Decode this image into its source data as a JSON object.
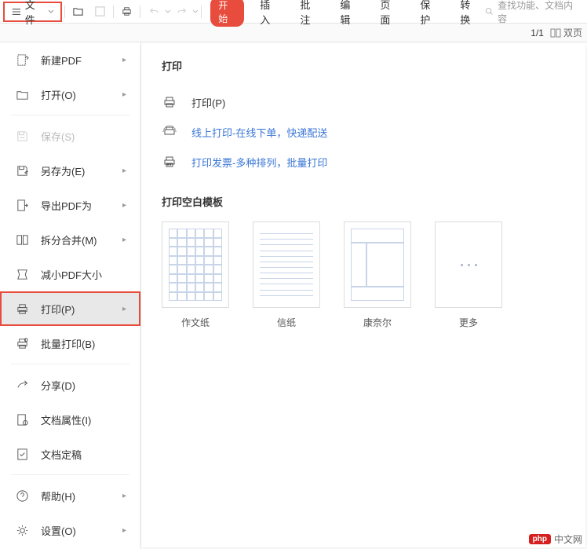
{
  "toolbar": {
    "file_label": "文件",
    "tabs": [
      "开始",
      "插入",
      "批注",
      "编辑",
      "页面",
      "保护",
      "转换"
    ],
    "search_placeholder": "查找功能、文档内容"
  },
  "secondbar": {
    "page": "1/1",
    "view_label": "双页"
  },
  "sidebar": {
    "groups": [
      [
        {
          "label": "新建PDF",
          "arrow": true,
          "disabled": false
        },
        {
          "label": "打开(O)",
          "arrow": true,
          "disabled": false
        }
      ],
      [
        {
          "label": "保存(S)",
          "arrow": false,
          "disabled": true
        },
        {
          "label": "另存为(E)",
          "arrow": true,
          "disabled": false
        },
        {
          "label": "导出PDF为",
          "arrow": true,
          "disabled": false
        },
        {
          "label": "拆分合并(M)",
          "arrow": true,
          "disabled": false
        },
        {
          "label": "减小PDF大小",
          "arrow": false,
          "disabled": false
        },
        {
          "label": "打印(P)",
          "arrow": true,
          "disabled": false,
          "active": true,
          "highlighted": true
        },
        {
          "label": "批量打印(B)",
          "arrow": false,
          "disabled": false
        }
      ],
      [
        {
          "label": "分享(D)",
          "arrow": false,
          "disabled": false
        },
        {
          "label": "文档属性(I)",
          "arrow": false,
          "disabled": false
        },
        {
          "label": "文档定稿",
          "arrow": false,
          "disabled": false
        }
      ],
      [
        {
          "label": "帮助(H)",
          "arrow": true,
          "disabled": false
        },
        {
          "label": "设置(O)",
          "arrow": true,
          "disabled": false
        }
      ]
    ]
  },
  "panel": {
    "title1": "打印",
    "row_print": "打印(P)",
    "row_online": "线上打印-在线下单，快递配送",
    "row_invoice": "打印发票-多种排列，批量打印",
    "title2": "打印空白模板",
    "templates": [
      "作文纸",
      "信纸",
      "康奈尔",
      "更多"
    ]
  },
  "watermark": {
    "badge": "php",
    "text": "中文网"
  }
}
